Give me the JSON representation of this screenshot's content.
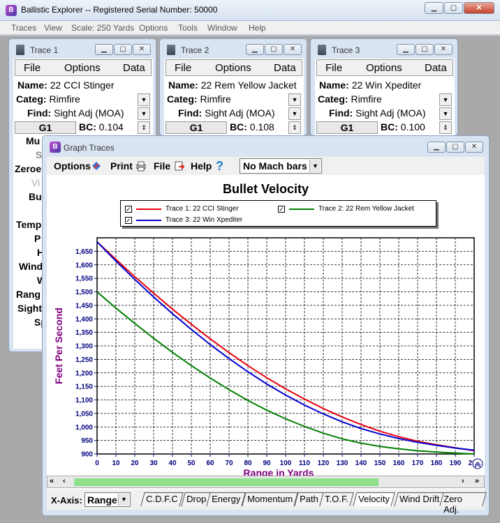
{
  "app": {
    "title": "Ballistic Explorer  --  Registered Serial Number: 50000",
    "icon": "app-logo-icon",
    "menu": [
      "Traces",
      "View",
      "Scale: 250 Yards",
      "Options",
      "Tools",
      "Window",
      "Help"
    ],
    "window_buttons": {
      "minimize": "▁",
      "maximize": "▢",
      "close": "✕"
    }
  },
  "traces": [
    {
      "title": "Trace 1",
      "menu": [
        "File",
        "Options",
        "Data"
      ],
      "name_label": "Name:",
      "name": "22 CCI Stinger",
      "categ_label": "Categ:",
      "categ": "Rimfire",
      "find_label": "Find:",
      "find": "Sight Adj (MOA)",
      "g": "G1",
      "bc_label": "BC:",
      "bc": "0.104"
    },
    {
      "title": "Trace 2",
      "menu": [
        "File",
        "Options",
        "Data"
      ],
      "name_label": "Name:",
      "name": "22 Rem Yellow Jacket",
      "categ_label": "Categ:",
      "categ": "Rimfire",
      "find_label": "Find:",
      "find": "Sight Adj (MOA)",
      "g": "G1",
      "bc_label": "BC:",
      "bc": "0.108"
    },
    {
      "title": "Trace 3",
      "menu": [
        "File",
        "Options",
        "Data"
      ],
      "name_label": "Name:",
      "name": "22 Win Xpediter",
      "categ_label": "Categ:",
      "categ": "Rimfire",
      "find_label": "Find:",
      "find": "Sight Adj (MOA)",
      "g": "G1",
      "bc_label": "BC:",
      "bc": "0.100"
    }
  ],
  "trace1_partial_labels": [
    "Mu",
    "S",
    "Zeroe",
    "Vi",
    "Bu",
    "Temp",
    "P",
    "H",
    "Wind",
    "W",
    "Rang",
    "Sight",
    "Sp"
  ],
  "graph": {
    "window_title": "Graph Traces",
    "toolbar": {
      "options": "Options",
      "print": "Print",
      "file": "File",
      "help": "Help",
      "mach_select": "No Mach bars"
    },
    "xaxis_label": "X-Axis:",
    "xaxis_select": "Range",
    "tabs": [
      "C.D.F.C",
      "Drop",
      "Energy",
      "Momentum",
      "Path",
      "T.O.F.",
      "Velocity",
      "Wind Drift",
      "Zero Adj."
    ],
    "active_tab": "Velocity",
    "colors": {
      "trace1": "#e8000b",
      "trace2": "#008000",
      "trace3": "#0000d0",
      "axis_label": "#800080",
      "tick": "#000080"
    }
  },
  "chart_data": {
    "type": "line",
    "title": "Bullet Velocity",
    "xlabel": "Range in Yards",
    "ylabel": "Feet Per Second",
    "xlim": [
      0,
      200
    ],
    "ylim": [
      900,
      1700
    ],
    "xticks": [
      0,
      10,
      20,
      30,
      40,
      50,
      60,
      70,
      80,
      90,
      100,
      110,
      120,
      130,
      140,
      150,
      160,
      170,
      180,
      190,
      200
    ],
    "yticks": [
      "900",
      "950",
      "1,000",
      "1,050",
      "1,100",
      "1,150",
      "1,200",
      "1,250",
      "1,300",
      "1,350",
      "1,400",
      "1,450",
      "1,500",
      "1,550",
      "1,600",
      "1,650"
    ],
    "ytick_values": [
      900,
      950,
      1000,
      1050,
      1100,
      1150,
      1200,
      1250,
      1300,
      1350,
      1400,
      1450,
      1500,
      1550,
      1600,
      1650
    ],
    "grid": true,
    "legend_position": "top",
    "x": [
      0,
      10,
      20,
      30,
      40,
      50,
      60,
      70,
      80,
      90,
      100,
      110,
      120,
      130,
      140,
      150,
      160,
      170,
      180,
      190,
      200
    ],
    "series": [
      {
        "name": "Trace 1: 22 CCI Stinger",
        "values": [
          1685,
          1620,
          1556,
          1495,
          1436,
          1380,
          1326,
          1275,
          1227,
          1182,
          1141,
          1103,
          1068,
          1037,
          1009,
          984,
          964,
          947,
          934,
          923,
          912
        ]
      },
      {
        "name": "Trace 2: 22 Rem Yellow Jacket",
        "values": [
          1500,
          1440,
          1383,
          1328,
          1276,
          1227,
          1181,
          1138,
          1098,
          1062,
          1030,
          1002,
          977,
          956,
          940,
          928,
          919,
          912,
          907,
          903,
          900
        ]
      },
      {
        "name": "Trace 3: 22 Win Xpediter",
        "values": [
          1685,
          1614,
          1546,
          1481,
          1419,
          1361,
          1305,
          1253,
          1204,
          1159,
          1118,
          1081,
          1048,
          1019,
          994,
          974,
          957,
          943,
          932,
          922,
          914
        ]
      }
    ]
  }
}
